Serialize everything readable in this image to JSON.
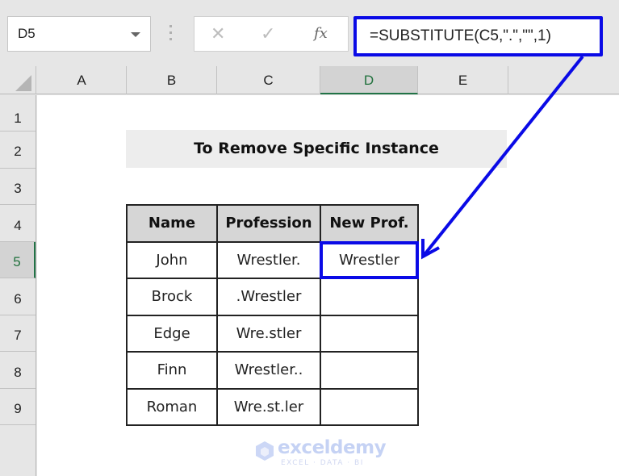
{
  "formula_bar": {
    "name_box": "D5",
    "cancel_icon": "✕",
    "enter_icon": "✓",
    "fx_label": "fx",
    "formula": "=SUBSTITUTE(C5,\".\",\"\",1)"
  },
  "columns": [
    "A",
    "B",
    "C",
    "D",
    "E"
  ],
  "active_column": "D",
  "rows": [
    "1",
    "2",
    "3",
    "4",
    "5",
    "6",
    "7",
    "8",
    "9"
  ],
  "active_row": "5",
  "sheet": {
    "title": "To Remove Specific Instance",
    "table": {
      "headers": [
        "Name",
        "Profession",
        "New Prof."
      ],
      "rows": [
        [
          "John",
          "Wrestler.",
          "Wrestler"
        ],
        [
          "Brock",
          ".Wrestler",
          ""
        ],
        [
          "Edge",
          "Wre.stler",
          ""
        ],
        [
          "Finn",
          "Wrestler..",
          ""
        ],
        [
          "Roman",
          "Wre.st.ler",
          ""
        ]
      ]
    }
  },
  "annotation": {
    "highlight_color": "#0a0ae6"
  },
  "watermark": {
    "brand": "exceldemy",
    "tagline": "EXCEL · DATA · BI"
  }
}
